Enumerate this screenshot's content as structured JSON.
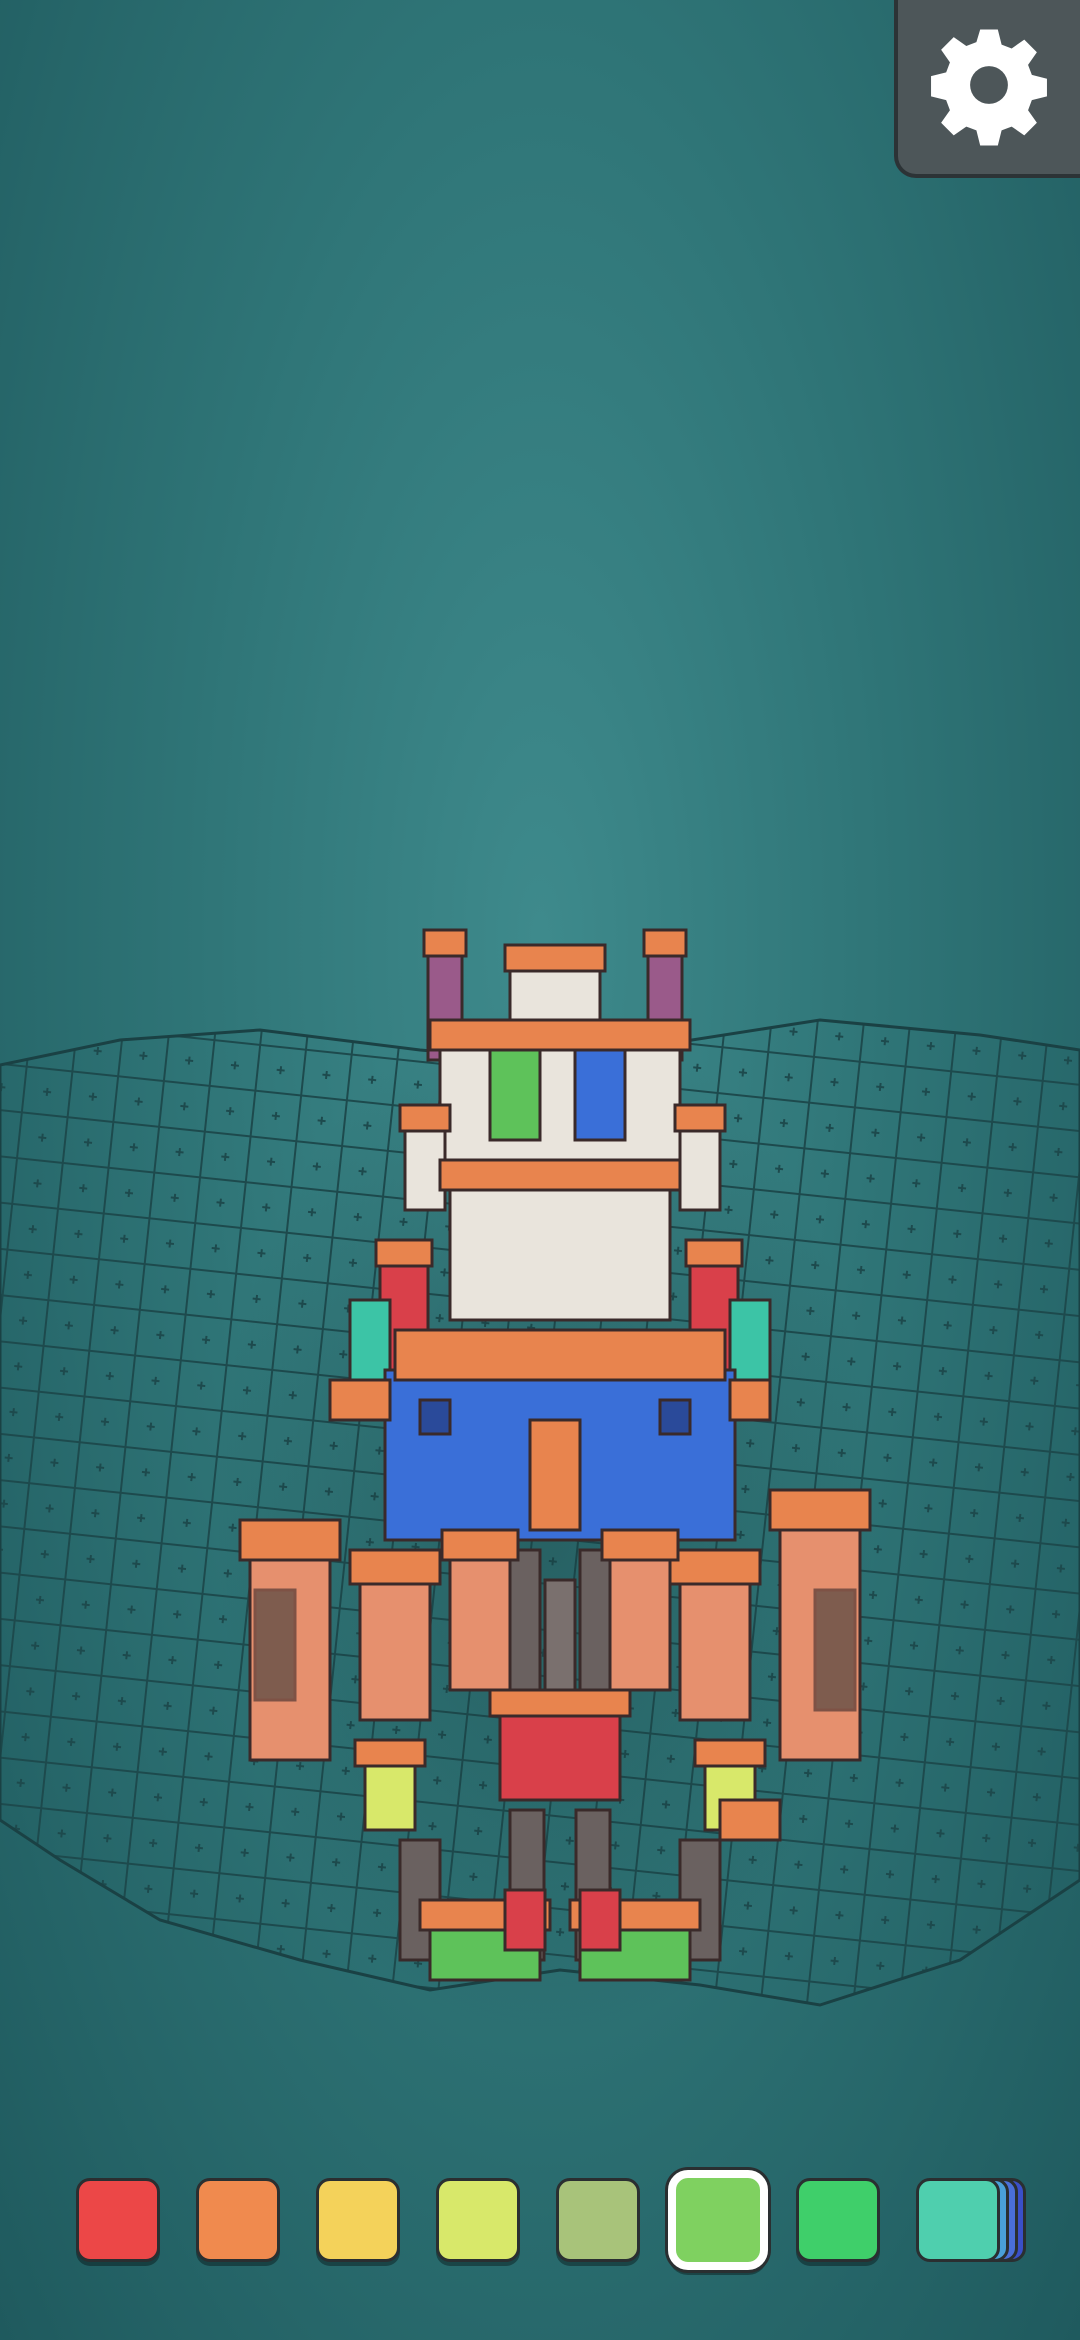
{
  "game": {
    "icons": {
      "settings": "gear-icon"
    },
    "colors": {
      "sea": "#2f7577",
      "grid_line": "#1e4c4f",
      "roof": "#e8844e",
      "blue": "#3a6fd8",
      "pink": "#e6906e",
      "white": "#e9e4dc",
      "red": "#d9404a",
      "green": "#5ec25a",
      "purple": "#9a5a8a",
      "teal": "#3cc4a6"
    },
    "palette": [
      {
        "name": "red",
        "color": "#ec4747",
        "selected": false
      },
      {
        "name": "orange",
        "color": "#f08a4e",
        "selected": false
      },
      {
        "name": "yellow",
        "color": "#f4d25a",
        "selected": false
      },
      {
        "name": "lime",
        "color": "#d8e86a",
        "selected": false
      },
      {
        "name": "olive-green",
        "color": "#a8c37a",
        "selected": false
      },
      {
        "name": "light-green",
        "color": "#7fd160",
        "selected": true
      },
      {
        "name": "green",
        "color": "#3fcf6a",
        "selected": false
      },
      {
        "name": "teal",
        "color": "#4fcfae",
        "selected": false
      },
      {
        "name": "blue-stack",
        "color": "#4a6fd8",
        "selected": false
      }
    ]
  }
}
